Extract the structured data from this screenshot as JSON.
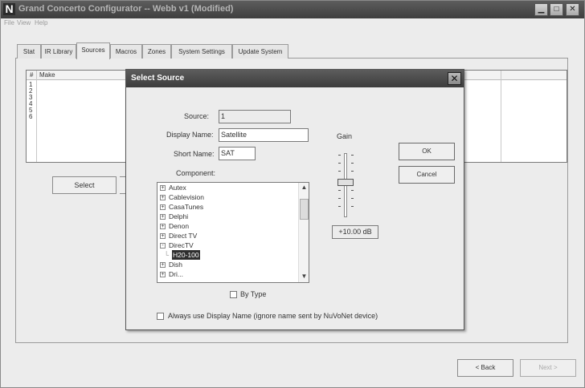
{
  "app": {
    "title": "Grand Concerto Configurator -- Webb v1 (Modified)",
    "icon_letter": "N",
    "controls": {
      "minimize": "▁",
      "maximize": "□",
      "close": "✕"
    }
  },
  "menu": [
    "File",
    "View",
    "Help"
  ],
  "tabs": [
    "Stat",
    "IR Library",
    "Sources",
    "Macros",
    "Zones",
    "System Settings",
    "Update System"
  ],
  "active_tab": "Sources",
  "grid": {
    "headers": [
      "#",
      "Make"
    ],
    "rows": [
      "1",
      "2",
      "3",
      "4",
      "5",
      "6"
    ]
  },
  "main_buttons": {
    "select": "Select",
    "back": "< Back",
    "next": "Next >"
  },
  "dialog": {
    "title": "Select Source",
    "source_label": "Source:",
    "source_value": "1",
    "display_name_label": "Display Name:",
    "display_name_value": "Satellite",
    "short_name_label": "Short Name:",
    "short_name_value": "SAT",
    "component_label": "Component:",
    "gain_label": "Gain",
    "gain_value": "+10.00 dB",
    "ok": "OK",
    "cancel": "Cancel",
    "tree": [
      {
        "label": "Autex",
        "expander": "+",
        "level": 0
      },
      {
        "label": "Cablevision",
        "expander": "+",
        "level": 0
      },
      {
        "label": "CasaTunes",
        "expander": "+",
        "level": 0
      },
      {
        "label": "Delphi",
        "expander": "+",
        "level": 0
      },
      {
        "label": "Denon",
        "expander": "+",
        "level": 0
      },
      {
        "label": "Direct TV",
        "expander": "+",
        "level": 0
      },
      {
        "label": "DirecTV",
        "expander": "-",
        "level": 0
      },
      {
        "label": "H20-100",
        "expander": "",
        "level": 1,
        "selected": true
      },
      {
        "label": "Dish",
        "expander": "+",
        "level": 0
      },
      {
        "label": "Dri...",
        "expander": "+",
        "level": 0
      }
    ],
    "by_type": "By Type",
    "always_use": "Always use Display Name (ignore name sent by NuVoNet device)"
  }
}
